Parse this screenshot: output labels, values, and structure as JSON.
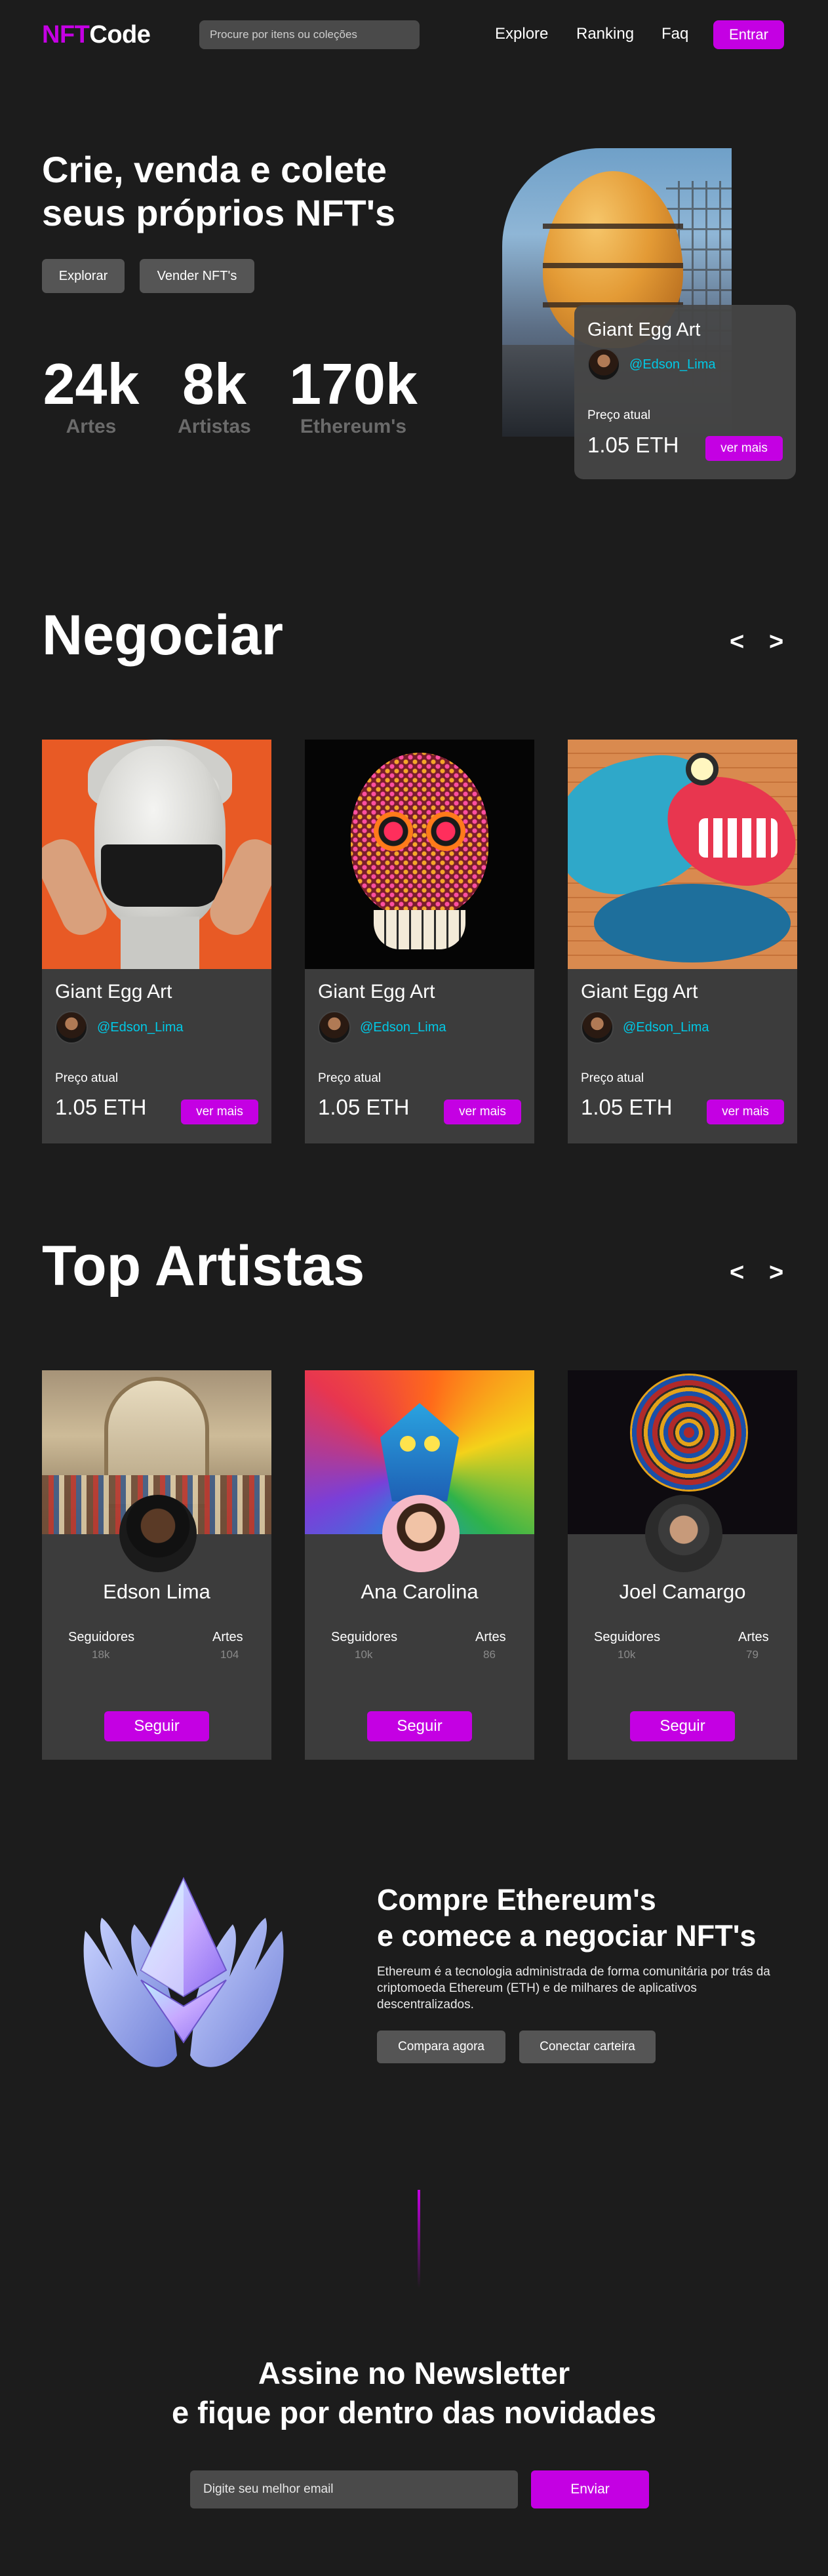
{
  "nav": {
    "logo_a": "NFT",
    "logo_b": "Code",
    "search_placeholder": "Procure por itens ou coleções",
    "links": [
      "Explore",
      "Ranking",
      "Faq"
    ],
    "login_label": "Entrar"
  },
  "hero": {
    "title": "Crie, venda e colete seus próprios NFT's",
    "buttons": [
      "Explorar",
      "Vender NFT's"
    ],
    "stats": [
      {
        "value": "24k",
        "label": "Artes"
      },
      {
        "value": "8k",
        "label": "Artistas"
      },
      {
        "value": "170k",
        "label": "Ethereum's"
      }
    ],
    "card": {
      "title": "Giant Egg Art",
      "handle": "@Edson_Lima",
      "price_label": "Preço atual",
      "price": "1.05 ETH",
      "button": "ver mais"
    }
  },
  "trade": {
    "title": "Negociar",
    "prev": "<",
    "next": ">",
    "cards": [
      {
        "name": "Giant Egg Art",
        "handle": "@Edson_Lima",
        "price_label": "Preço atual",
        "price": "1.05 ETH",
        "button": "ver mais"
      },
      {
        "name": "Giant Egg Art",
        "handle": "@Edson_Lima",
        "price_label": "Preço atual",
        "price": "1.05 ETH",
        "button": "ver mais"
      },
      {
        "name": "Giant Egg Art",
        "handle": "@Edson_Lima",
        "price_label": "Preço atual",
        "price": "1.05 ETH",
        "button": "ver mais"
      }
    ]
  },
  "artists": {
    "title": "Top Artistas",
    "prev": "<",
    "next": ">",
    "cards": [
      {
        "name": "Edson Lima",
        "followers_label": "Seguidores",
        "followers": "18k",
        "arts_label": "Artes",
        "arts": "104",
        "button": "Seguir"
      },
      {
        "name": "Ana Carolina",
        "followers_label": "Seguidores",
        "followers": "10k",
        "arts_label": "Artes",
        "arts": "86",
        "button": "Seguir"
      },
      {
        "name": "Joel Camargo",
        "followers_label": "Seguidores",
        "followers": "10k",
        "arts_label": "Artes",
        "arts": "79",
        "button": "Seguir"
      }
    ]
  },
  "eth": {
    "title_line1": "Compre Ethereum's",
    "title_line2": "e comece a negociar NFT's",
    "description": "Ethereum é a tecnologia administrada de forma comunitária por trás da criptomoeda Ethereum (ETH) e de milhares de aplicativos descentralizados.",
    "buttons": [
      "Compara agora",
      "Conectar carteira"
    ]
  },
  "newsletter": {
    "title_line1": "Assine no Newsletter",
    "title_line2": "e fique por dentro das novidades",
    "placeholder": "Digite seu melhor email",
    "button": "Enviar"
  },
  "colors": {
    "accent": "#c400e3",
    "handle": "#00c9e6",
    "background": "#1c1c1c",
    "card": "#3c3c3c"
  }
}
